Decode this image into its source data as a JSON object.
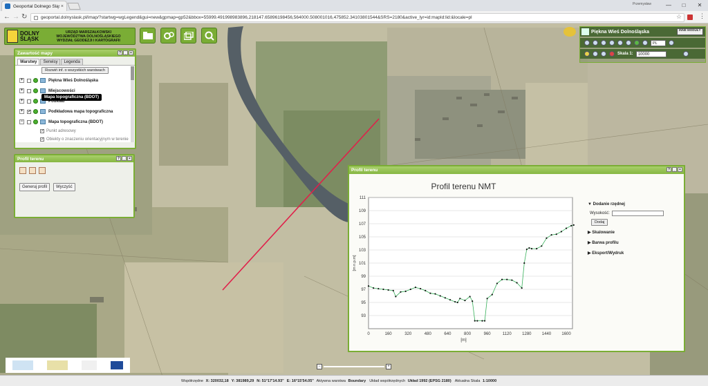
{
  "browser": {
    "tab_title": "Geoportal Dolnego Śląsk",
    "tab_close": "×",
    "user": "Przemysław",
    "url": "geoportal.dolnyslask.pl/imap/?startwg=wgLegend&gui=new&gpmap=gp52&bbox=55999.491998983896,218147.65896198456,564000.508001016,475852.34103801544&SRS=2180&active_lyr=id:mapId:lid:&locale=pl",
    "win_min": "—",
    "win_max": "□",
    "win_close": "✕"
  },
  "header": {
    "brand_line1": "DOLNY",
    "brand_line2": "ŚLĄSK",
    "office_line1": "URZĄD MARSZAŁKOWSKI",
    "office_line2": "WOJEWÓDZTWA DOLNOŚLĄSKIEGO",
    "office_line3": "WYDZIAŁ GEODEZJI I KARTOGRAFII"
  },
  "layers_panel": {
    "title": "Zawartość mapy",
    "tabs": [
      "Warstwy",
      "Serwisy",
      "Legenda"
    ],
    "expand_button": "Rozwiń inf. o wszystkich warstwach",
    "layers": [
      "Piękna Wieś Dolnośląska",
      "Miejscowości",
      "Podkład",
      "Podkładowa mapa topograficzna",
      "Mapa topograficzna (BDOT)"
    ],
    "sublayers": [
      "Punkt adresowy",
      "Obiekty o znaczeniu orientacyjnym w terenie"
    ],
    "tooltip": "Mapa topograficzna (BDOT)"
  },
  "profile_tool": {
    "title": "Profil terenu",
    "generate_button": "Generuj profil",
    "clear_button": "Wyczyść"
  },
  "theme_panel": {
    "title": "Piękna Wieś Dolnośląska",
    "modules_label": "INNE MODUŁY",
    "lang": "PL",
    "scale_label": "Skala 1:",
    "scale_value": "10000"
  },
  "nmt_window": {
    "title": "Profil terenu",
    "chart_title": "Profil terenu NMT",
    "add_ordinate": "Dodanie rzędnej",
    "height_label": "Wysokość:",
    "add_button": "Dodaj",
    "scaling": "Skalowanie",
    "profile_color": "Barwa profilu",
    "export": "Eksport/Wydruk",
    "y_unit": "[m n.p.m]",
    "x_unit": "[m]"
  },
  "statusbar": {
    "coords_label": "Współrzędne",
    "x": "X: 320032,18",
    "y": "Y: 381989,29",
    "n": "N: 51°17'14.93\"",
    "e": "E: 16°15'54.05\"",
    "active_layer_label": "Aktywna warstwa",
    "active_layer": "Boundary",
    "crs_label": "Układ współrzędnych",
    "crs": "Układ 1992 (EPSG 2180)",
    "scale_label": "Aktualna Skala",
    "scale": "1:10000"
  },
  "chart_data": {
    "type": "line",
    "title": "Profil terenu NMT",
    "xlabel": "[m]",
    "ylabel": "[m n.p.m]",
    "xlim": [
      0,
      1650
    ],
    "ylim": [
      91,
      111
    ],
    "xticks": [
      0,
      160,
      320,
      480,
      640,
      800,
      960,
      1120,
      1280,
      1440,
      1600
    ],
    "yticks": [
      93,
      95,
      97,
      99,
      101,
      103,
      105,
      107,
      109,
      111
    ],
    "grid": true,
    "x": [
      0,
      40,
      80,
      120,
      160,
      200,
      220,
      260,
      300,
      340,
      380,
      420,
      460,
      500,
      540,
      580,
      620,
      660,
      700,
      720,
      740,
      780,
      820,
      840,
      860,
      880,
      920,
      940,
      960,
      1000,
      1040,
      1080,
      1120,
      1160,
      1200,
      1240,
      1260,
      1280,
      1300,
      1320,
      1360,
      1400,
      1440,
      1480,
      1520,
      1560,
      1600,
      1640,
      1660
    ],
    "y": [
      97.5,
      97.2,
      97.1,
      97.0,
      96.9,
      96.8,
      95.9,
      96.6,
      96.7,
      97.0,
      97.3,
      97.1,
      96.8,
      96.4,
      96.3,
      96.0,
      95.7,
      95.4,
      95.1,
      95.0,
      95.6,
      95.3,
      95.9,
      95.2,
      92.2,
      92.2,
      92.2,
      92.2,
      95.6,
      96.2,
      97.9,
      98.5,
      98.5,
      98.4,
      98.0,
      97.2,
      101.0,
      103.1,
      103.3,
      103.2,
      103.2,
      103.6,
      104.8,
      105.3,
      105.4,
      105.8,
      106.3,
      106.7,
      106.8
    ]
  }
}
